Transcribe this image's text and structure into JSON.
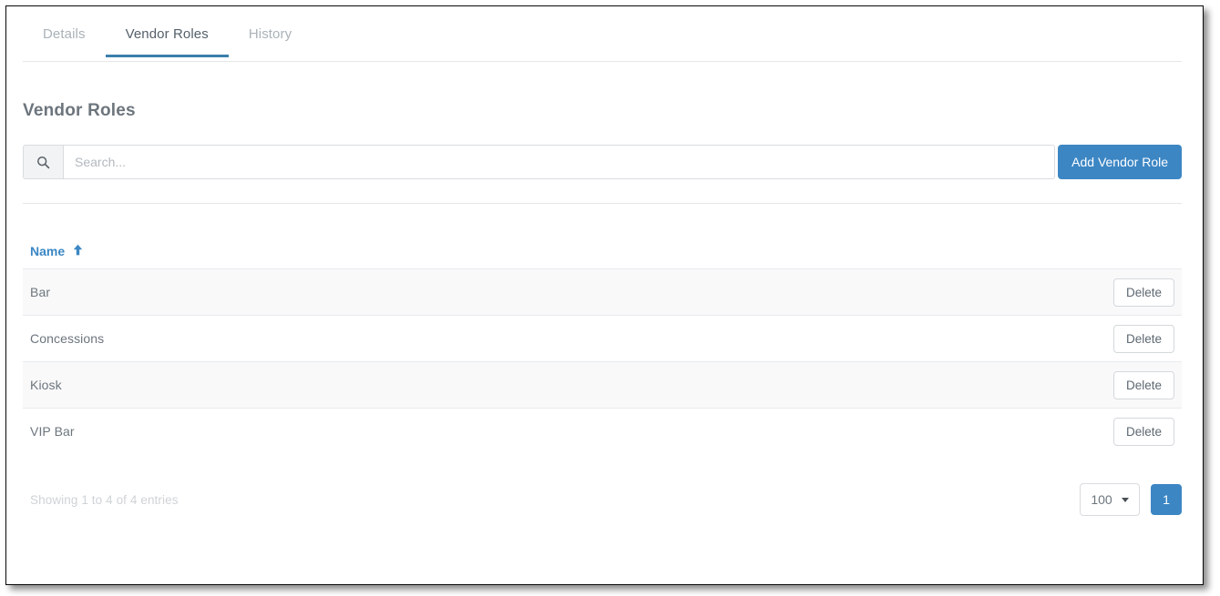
{
  "tabs": [
    {
      "label": "Details",
      "active": false
    },
    {
      "label": "Vendor Roles",
      "active": true
    },
    {
      "label": "History",
      "active": false
    }
  ],
  "page": {
    "title": "Vendor Roles"
  },
  "toolbar": {
    "search_icon": "search-icon",
    "search_value": "",
    "search_placeholder": "Search...",
    "add_button_label": "Add Vendor Role"
  },
  "table": {
    "columns": [
      {
        "label": "Name",
        "sort": "asc",
        "sort_icon": "arrow-up-icon"
      }
    ],
    "rows": [
      {
        "name": "Bar",
        "action_label": "Delete"
      },
      {
        "name": "Concessions",
        "action_label": "Delete"
      },
      {
        "name": "Kiosk",
        "action_label": "Delete"
      },
      {
        "name": "VIP Bar",
        "action_label": "Delete"
      }
    ]
  },
  "footer": {
    "entries_info": "Showing 1 to 4 of 4 entries",
    "page_size": "100",
    "page_size_caret": "chevron-down-icon",
    "pages": [
      {
        "label": "1",
        "active": true
      }
    ]
  },
  "colors": {
    "accent_blue": "#3c86c4",
    "tab_underline": "#3b7fab",
    "header_link": "#3b87c4",
    "text_muted": "#6c757d",
    "text_faint": "#cfd3d7",
    "row_stripe": "#f9f9fa",
    "border": "#e4e6e8"
  }
}
